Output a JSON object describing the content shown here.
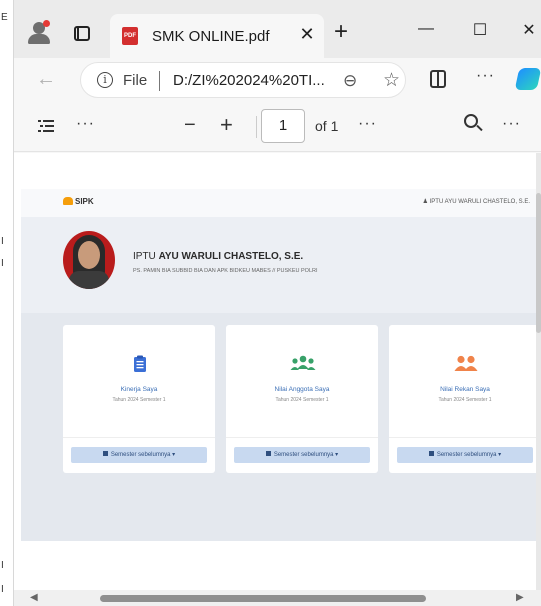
{
  "browser": {
    "tab_title": "SMK ONLINE.pdf",
    "tab_close": "✕",
    "new_tab": "+",
    "minimize": "—",
    "maximize": "☐",
    "close": "✕",
    "scheme_label": "File",
    "url": "D:/ZI%202024%20TI...",
    "more": "···",
    "pdf_badge": "PDF"
  },
  "pdf_toolbar": {
    "zoom_out": "−",
    "zoom_in": "+",
    "page_current": "1",
    "page_of": "of 1",
    "more": "···"
  },
  "document": {
    "brand": "SIPK",
    "header_user": "IPTU AYU WARULI CHASTELO, S.E.",
    "profile_rank": "IPTU ",
    "profile_name": "AYU WARULI CHASTELO, S.E.",
    "profile_role": "PS. PAMIN BIA SUBBID BIA DAN APK BIDKEU MABES // PUSKEU POLRI",
    "cards": [
      {
        "title": "Kinerja Saya",
        "subtitle": "Tahun 2024 Semester 1",
        "button": "Semester sebelumnya ▾",
        "icon": "clipboard-icon",
        "icon_color": "#3b6fd6"
      },
      {
        "title": "Nilai Anggota Saya",
        "subtitle": "Tahun 2024 Semester 1",
        "button": "Semester sebelumnya ▾",
        "icon": "users-icon",
        "icon_color": "#38a169"
      },
      {
        "title": "Nilai Rekan Saya",
        "subtitle": "Tahun 2024 Semester 1",
        "button": "Semester sebelumnya ▾",
        "icon": "user-pair-icon",
        "icon_color": "#f0834a"
      }
    ]
  },
  "left_edge_marks": [
    "E",
    "I",
    "I",
    "I",
    "I"
  ]
}
